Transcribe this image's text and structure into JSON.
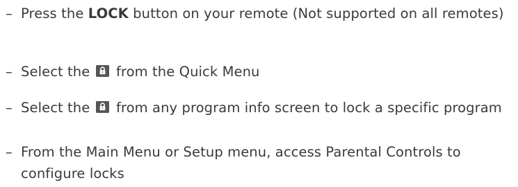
{
  "bullet_marker": "–",
  "items": [
    {
      "before": "Press the ",
      "bold": "LOCK",
      "after": " button on your remote (Not supported on all remotes)"
    },
    {
      "before": "Select the ",
      "icon": "lock-icon",
      "after": " from the Quick Menu"
    },
    {
      "before": "Select the ",
      "icon": "lock-icon",
      "after": " from any program info screen to lock a specific program"
    },
    {
      "text": "From the Main Menu or Setup menu, access Parental Controls to configure locks"
    }
  ],
  "colors": {
    "text": "#3a3a3a",
    "icon_background": "#555555",
    "icon_glyph": "#ffffff"
  }
}
